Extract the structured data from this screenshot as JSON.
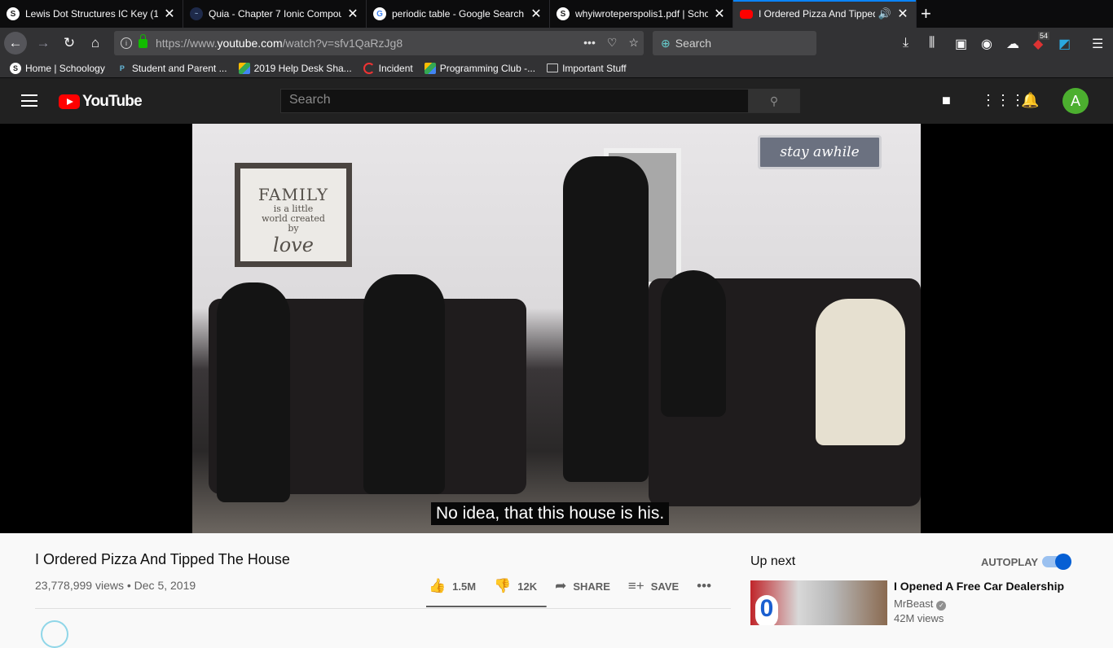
{
  "browser": {
    "tabs": [
      {
        "title": "Lewis Dot Structures IC Key (1)",
        "favicon": "schoology-icon",
        "active": false
      },
      {
        "title": "Quia - Chapter 7 Ionic Compou",
        "favicon": "quia-icon",
        "active": false
      },
      {
        "title": "periodic table - Google Search",
        "favicon": "google-icon",
        "active": false
      },
      {
        "title": "whyiwroteperspolis1.pdf | Scho",
        "favicon": "schoology-icon",
        "active": false
      },
      {
        "title": "I Ordered Pizza And Tipped",
        "favicon": "youtube-icon",
        "active": true
      }
    ],
    "url_prefix": "https://www.",
    "url_domain": "youtube.com",
    "url_path": "/watch?v=sfv1QaRzJg8",
    "search_placeholder": "Search",
    "badge_count": "54",
    "bookmarks": [
      {
        "label": "Home | Schoology",
        "icon": "schoology-icon"
      },
      {
        "label": "Student and Parent ...",
        "icon": "parent-portal-icon"
      },
      {
        "label": "2019 Help Desk Sha...",
        "icon": "google-drive-icon"
      },
      {
        "label": "Incident",
        "icon": "incident-icon"
      },
      {
        "label": "Programming Club -...",
        "icon": "google-drive-icon"
      },
      {
        "label": "Important Stuff",
        "icon": "folder-icon"
      }
    ]
  },
  "youtube": {
    "logo_text": "YouTube",
    "search_placeholder": "Search",
    "avatar_letter": "A"
  },
  "video": {
    "subtitle": "No idea, that this house is his.",
    "frame_text": [
      "FAMILY",
      "is a little",
      "world created",
      "by",
      "love"
    ],
    "sign_text": "stay awhile",
    "title": "I Ordered Pizza And Tipped The House",
    "views": "23,778,999 views",
    "date": "Dec 5, 2019",
    "likes": "1.5M",
    "dislikes": "12K",
    "share_label": "SHARE",
    "save_label": "SAVE",
    "like_ratio": 0.992
  },
  "sidebar": {
    "up_next_label": "Up next",
    "autoplay_label": "AUTOPLAY",
    "autoplay_on": true,
    "next_video": {
      "title": "I Opened A Free Car Dealership",
      "channel": "MrBeast",
      "views": "42M views"
    }
  },
  "colors": {
    "accent": "#065fd4",
    "youtube_red": "#ff0000",
    "tab_highlight": "#0a84ff"
  }
}
